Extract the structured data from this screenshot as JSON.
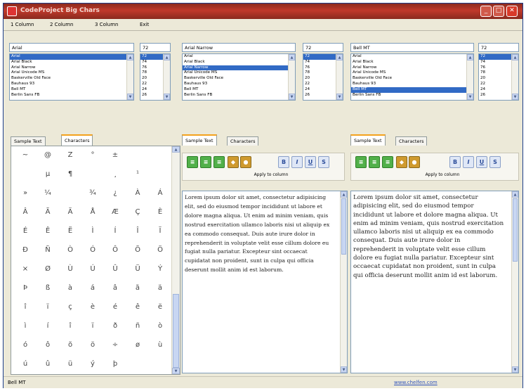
{
  "window": {
    "title": "CodeProject Big Chars",
    "minimize": "_",
    "maximize": "□",
    "close": "✕"
  },
  "menu": [
    "1 Column",
    "2 Column",
    "3 Column",
    "Exit"
  ],
  "columns": [
    {
      "font_value": "Arial",
      "size_value": "72",
      "fonts": [
        "Arial",
        "Arial Black",
        "Arial Narrow",
        "Arial Unicode MS",
        "Baskerville Old Face",
        "Bauhaus 93",
        "Bell MT",
        "Berlin Sans FB"
      ],
      "font_selected": 0,
      "sizes": [
        "72",
        "74",
        "76",
        "78",
        "20",
        "22",
        "24",
        "26"
      ],
      "size_selected": 0
    },
    {
      "font_value": "Arial Narrow",
      "size_value": "72",
      "fonts": [
        "Arial",
        "Arial Black",
        "Arial Narrow",
        "Arial Unicode MS",
        "Baskerville Old Face",
        "Bauhaus 93",
        "Bell MT",
        "Berlin Sans FB"
      ],
      "font_selected": 2,
      "sizes": [
        "72",
        "74",
        "76",
        "78",
        "20",
        "22",
        "24",
        "26"
      ],
      "size_selected": 0
    },
    {
      "font_value": "Bell MT",
      "size_value": "72",
      "fonts": [
        "Arial",
        "Arial Black",
        "Arial Narrow",
        "Arial Unicode MS",
        "Baskerville Old Face",
        "Bauhaus 93",
        "Bell MT",
        "Berlin Sans FB"
      ],
      "font_selected": 6,
      "sizes": [
        "72",
        "74",
        "76",
        "78",
        "20",
        "22",
        "24",
        "26"
      ],
      "size_selected": 0
    }
  ],
  "tabs": {
    "sample": "Sample Text",
    "characters": "Characters"
  },
  "char_rows": [
    [
      "~",
      "@",
      "Z",
      "°",
      "±",
      "",
      ""
    ],
    [
      "",
      "µ",
      "¶",
      "",
      "¸",
      "¹",
      ""
    ],
    [
      "»",
      "¼",
      "",
      "¾",
      "¿",
      "À",
      "Á"
    ],
    [
      "Â",
      "Ã",
      "Ä",
      "Å",
      "Æ",
      "Ç",
      "È"
    ],
    [
      "É",
      "Ê",
      "Ë",
      "Ì",
      "Í",
      "Î",
      "Ï"
    ],
    [
      "Ð",
      "Ñ",
      "Ò",
      "Ó",
      "Ô",
      "Õ",
      "Ö"
    ],
    [
      "×",
      "Ø",
      "Ù",
      "Ú",
      "Û",
      "Ü",
      "Ý"
    ],
    [
      "Þ",
      "ß",
      "à",
      "á",
      "â",
      "ã",
      "ä"
    ],
    [
      "î",
      "ï",
      "ç",
      "è",
      "é",
      "ê",
      "ë"
    ],
    [
      "ì",
      "í",
      "î",
      "ï",
      "ð",
      "ñ",
      "ò"
    ],
    [
      "ó",
      "ô",
      "õ",
      "ö",
      "÷",
      "ø",
      "ù"
    ],
    [
      "ú",
      "û",
      "ü",
      "ý",
      "þ",
      "",
      ""
    ]
  ],
  "apply_label": "Apply to column",
  "sample_text": "Lorem ipsum dolor sit amet, consectetur adipisicing elit, sed do eiusmod tempor incididunt ut labore et dolore magna aliqua. Ut enim ad minim veniam, quis nostrud exercitation ullamco laboris nisi ut aliquip ex ea commodo consequat. Duis aute irure dolor in reprehenderit in voluptate velit esse cillum dolore eu fugiat nulla pariatur. Excepteur sint occaecat cupidatat non proident, sunt in culpa qui officia deserunt mollit anim id est laborum.",
  "status": {
    "left": "Bell MT",
    "right": "www.chelfen.com"
  },
  "colors": {
    "titlebar": "#b03020",
    "selection": "#316ac5",
    "accent_tab": "#f4a21c",
    "link": "#3355bb"
  }
}
